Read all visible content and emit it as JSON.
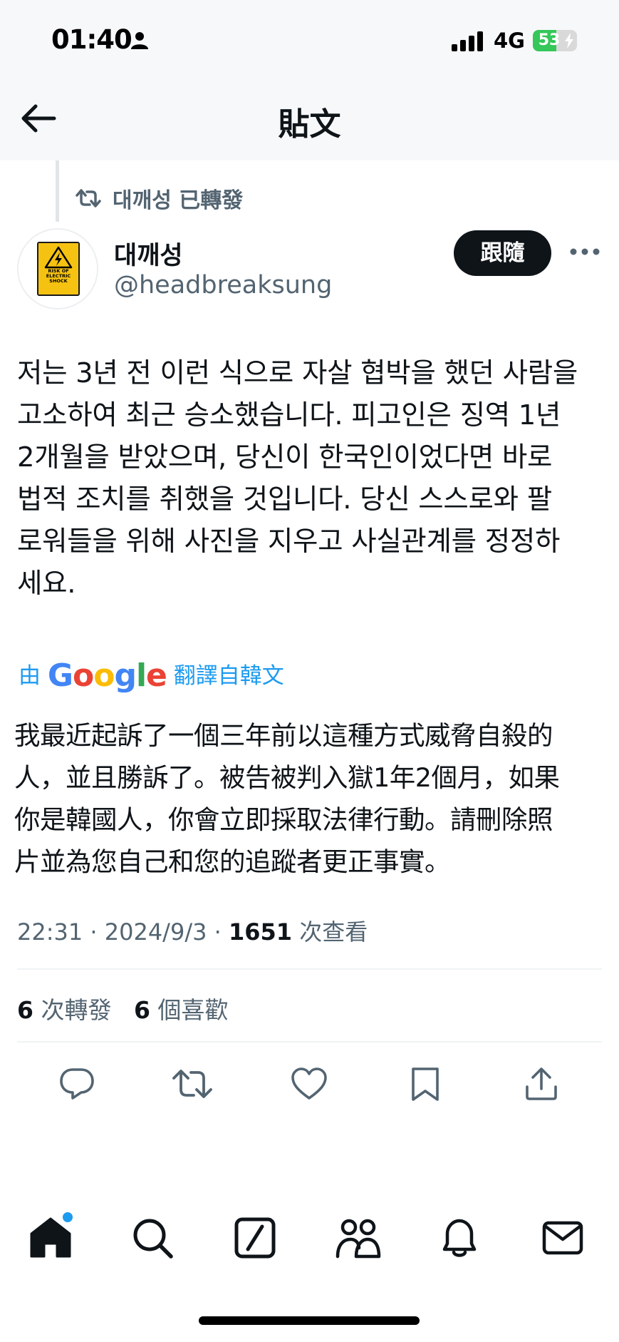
{
  "status_bar": {
    "time": "01:40",
    "network": "4G",
    "battery": "53",
    "battery_level": 0.53
  },
  "header": {
    "title": "貼文"
  },
  "retweet_context": {
    "text": "대깨성 已轉發"
  },
  "author": {
    "display_name": "대깨성",
    "handle": "@headbreaksung",
    "avatar_sign_text": "RISK OF ELECTRIC SHOCK"
  },
  "follow_button": {
    "label": "跟隨"
  },
  "tweet": {
    "lines": [
      "저는 3년 전 이런 식으로 자살 협박을 했던 사람을",
      "고소하여 최근 승소했습니다. 피고인은 징역 1년",
      "2개월을 받았으며, 당신이 한국인이었다면 바로",
      "법적 조치를 취했을 것입니다. 당신 스스로와 팔",
      "로워들을 위해 사진을 지우고 사실관계를 정정하",
      "세요."
    ]
  },
  "translation": {
    "prefix": "由",
    "provider": "Google",
    "suffix": "翻譯自韓文",
    "lines": [
      "我最近起訴了一個三年前以這種方式威脅自殺的",
      "人，並且勝訴了。被告被判入獄1年2個月，如果",
      "你是韓國人，你會立即採取法律行動。請刪除照",
      "片並為您自己和您的追蹤者更正事實。"
    ]
  },
  "meta": {
    "time": "22:31",
    "separator": "·",
    "date": "2024/9/3",
    "views_count": "1651",
    "views_label": "次查看"
  },
  "stats": {
    "retweets_count": "6",
    "retweets_label": "次轉發",
    "likes_count": "6",
    "likes_label": "個喜歡"
  },
  "actions": [
    "reply-icon",
    "retweet-icon",
    "like-icon",
    "bookmark-icon",
    "share-icon"
  ],
  "tabs": [
    "home-icon",
    "search-icon",
    "grok-icon",
    "communities-icon",
    "notifications-icon",
    "messages-icon"
  ],
  "colors": {
    "accent": "#1d9bf0",
    "text": "#0f1419",
    "secondary": "#536471"
  }
}
